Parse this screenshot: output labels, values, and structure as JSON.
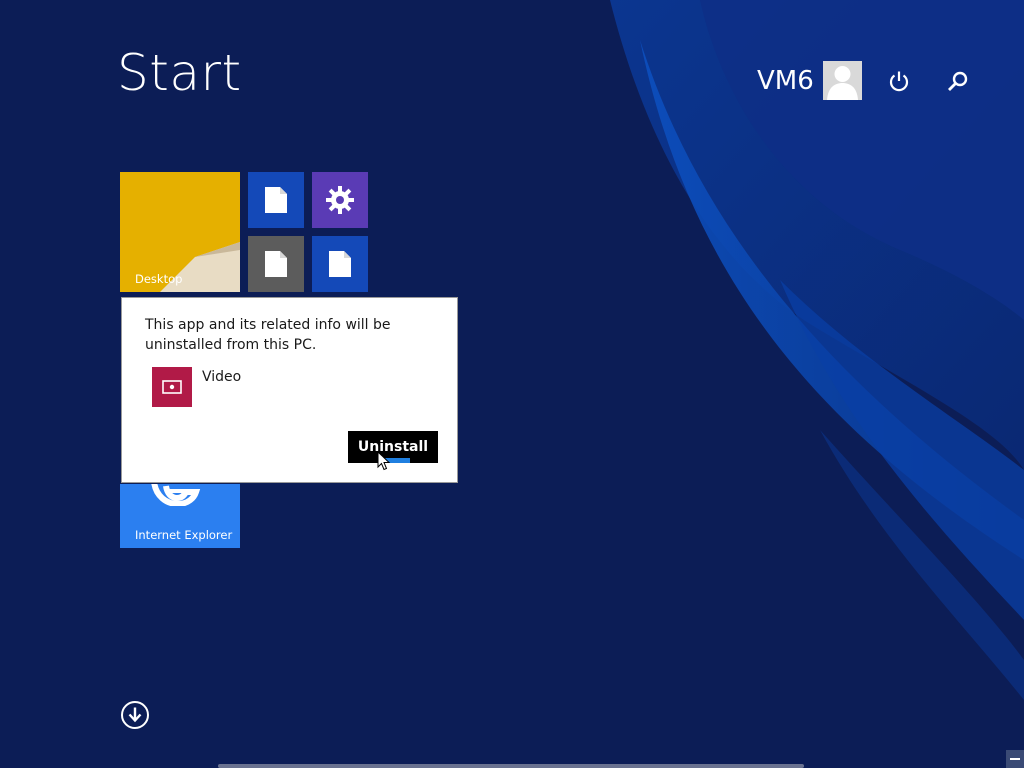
{
  "header": {
    "title": "Start",
    "user_name": "VM6",
    "icons": {
      "avatar": "user-avatar-icon",
      "power": "power-icon",
      "search": "search-icon"
    }
  },
  "tiles": {
    "desktop": {
      "label": "Desktop",
      "color": "#e5b000"
    },
    "doc1": {
      "icon": "document-icon",
      "color": "#1449b8"
    },
    "settings": {
      "icon": "gear-icon",
      "color": "#5a3bb5"
    },
    "doc2": {
      "icon": "document-icon",
      "color": "#5c5c5c"
    },
    "doc3": {
      "icon": "document-icon",
      "color": "#1449b8"
    },
    "ie": {
      "label": "Internet Explorer",
      "icon": "internet-explorer-icon",
      "color": "#2b7ff0"
    }
  },
  "dialog": {
    "message": "This app and its related info will be uninstalled from this PC.",
    "app_name": "Video",
    "app_icon": "video-icon",
    "app_color": "#b11a47",
    "button_label": "Uninstall"
  },
  "footer": {
    "all_apps_icon": "arrow-down-circle-icon",
    "zoom_icon": "minus-icon"
  },
  "colors": {
    "background": "#0c1d56",
    "accent": "#1f7fe0"
  }
}
